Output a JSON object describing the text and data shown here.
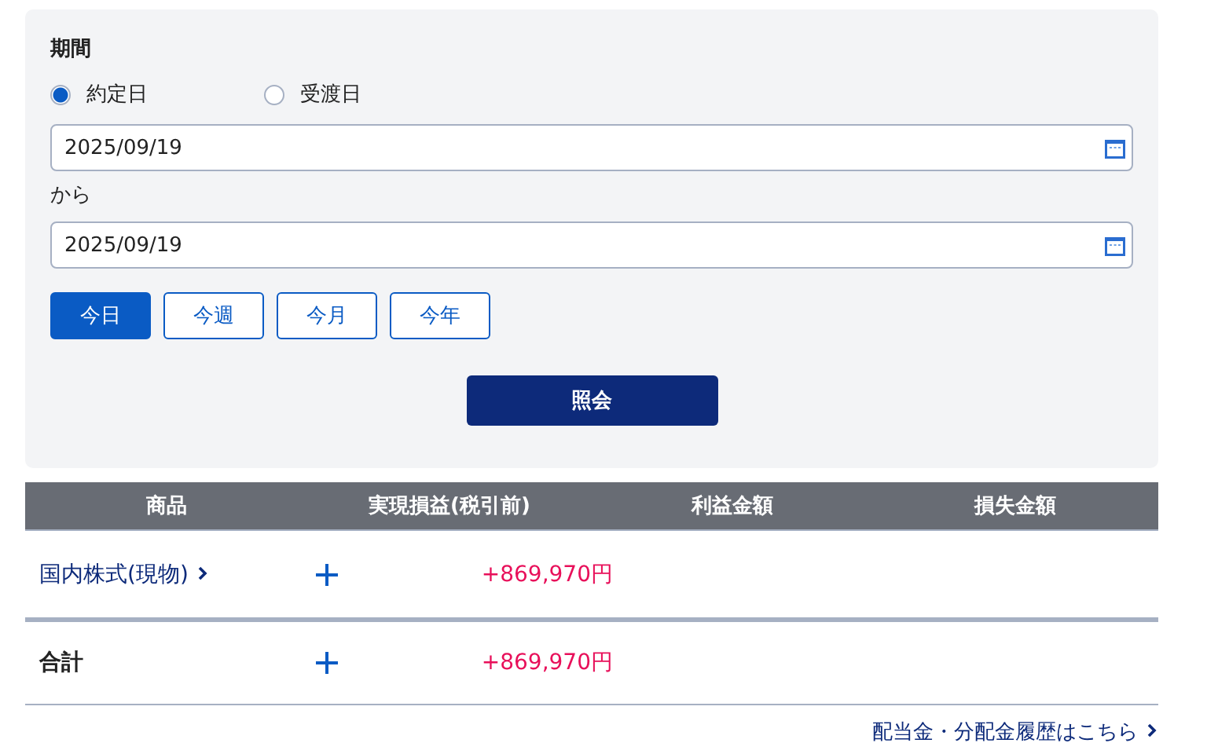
{
  "period": {
    "label": "期間",
    "date_types": [
      {
        "label": "約定日",
        "selected": true
      },
      {
        "label": "受渡日",
        "selected": false
      }
    ],
    "from_date": {
      "value": "2025/09/19"
    },
    "separator": "から",
    "to_date": {
      "value": "2025/09/19"
    },
    "quick_ranges": [
      {
        "label": "今日",
        "selected": true
      },
      {
        "label": "今週",
        "selected": false
      },
      {
        "label": "今月",
        "selected": false
      },
      {
        "label": "今年",
        "selected": false
      }
    ],
    "submit": "照会"
  },
  "table": {
    "columns": [
      "商品",
      "実現損益(税引前)",
      "利益金額",
      "損失金額"
    ],
    "rows": [
      {
        "kind": "link",
        "product": "国内株式(現物)",
        "realized": "+869,970円"
      },
      {
        "kind": "total",
        "product": "合計",
        "realized": "+869,970円"
      }
    ]
  },
  "footer_link": "配当金・分配金履歴はこちら"
}
